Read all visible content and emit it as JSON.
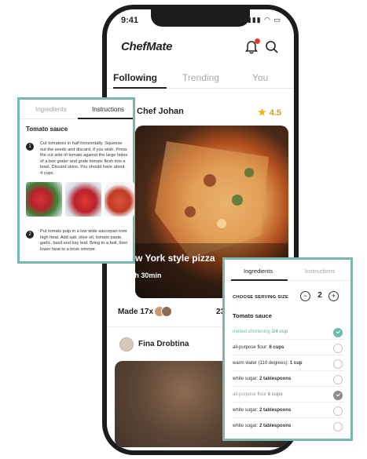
{
  "status": {
    "time": "9:41",
    "icons": "▮▮▮▮ ◠ ▭"
  },
  "app": {
    "brand": "ChefMate"
  },
  "tabs": [
    {
      "label": "Following",
      "active": true
    },
    {
      "label": "Trending",
      "active": false
    },
    {
      "label": "You",
      "active": false
    }
  ],
  "post": {
    "author": "Chef Johan",
    "rating": "4.5",
    "title": "w York style pizza",
    "time": "1h 30min",
    "made": "Made 17x",
    "made_extra": "23"
  },
  "post2": {
    "author": "Fina Drobtina"
  },
  "left_card": {
    "tabs": [
      "Ingredients",
      "Instructions"
    ],
    "section": "Tomato sauce",
    "steps": [
      {
        "num": "1",
        "text": "Cut tomatoes in half horizontally. Squeeze out the seeds and discard, if you wish. Press the cut side of tomato against the large holes of a box grater and grate tomato flesh into a bowl. Discard skins. You should have about 4 cups."
      },
      {
        "num": "2",
        "text": "Put tomato pulp in a low wide saucepan over high heat. Add salt, olive oil, tomato paste, garlic, basil and bay leaf. Bring to a boil, then lower heat to a brisk simmer."
      }
    ]
  },
  "right_card": {
    "tabs": [
      "Ingredients",
      "Instructions"
    ],
    "serving_label": "CHOOSE SERVING SIZE",
    "serving_value": "2",
    "minus": "−",
    "plus": "+",
    "section": "Tomato sauce",
    "ingredients": [
      {
        "name": "melted shortening",
        "amount": "1/4 cup",
        "state": "checked-teal"
      },
      {
        "name": "all-purpose flour:",
        "amount": "6 cups",
        "state": "empty"
      },
      {
        "name": "warm water (110 degrees):",
        "amount": "1 cup",
        "state": "empty"
      },
      {
        "name": "white sugar:",
        "amount": "2 tablespoons",
        "state": "empty"
      },
      {
        "name": "all-purpose flour",
        "amount": "6 cups",
        "state": "checked-grey"
      },
      {
        "name": "white sugar:",
        "amount": "2 tablespoons",
        "state": "empty"
      },
      {
        "name": "white sugar:",
        "amount": "2 tablespoons",
        "state": "empty"
      }
    ]
  },
  "colors": {
    "teal": "#79b8b1",
    "star": "#f2b400",
    "check_teal": "#6ebcae"
  }
}
